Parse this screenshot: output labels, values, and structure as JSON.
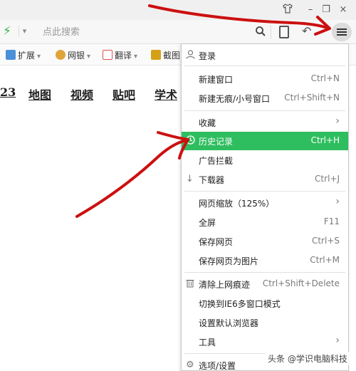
{
  "window": {
    "skin_icon": "tshirt-icon",
    "minimize_label": "–",
    "maximize_label": "❐",
    "close_label": "×"
  },
  "toolbar": {
    "search_placeholder": "点此搜索",
    "menu_icon": "hamburger-menu-icon"
  },
  "bookmarks": [
    {
      "label": "扩展",
      "color": "#4a90d9"
    },
    {
      "label": "网银",
      "color": "#e0a53a"
    },
    {
      "label": "翻译",
      "color": "#d9534f"
    },
    {
      "label": "截图",
      "color": "#d4a017"
    }
  ],
  "page_links": [
    "23",
    "地图",
    "视频",
    "贴吧",
    "学术"
  ],
  "menu": {
    "login": "登录",
    "new_window": {
      "label": "新建窗口",
      "shortcut": "Ctrl+N"
    },
    "new_incognito": {
      "label": "新建无痕/小号窗口",
      "shortcut": "Ctrl+Shift+N"
    },
    "favorites": {
      "label": "收藏"
    },
    "history": {
      "label": "历史记录",
      "shortcut": "Ctrl+H"
    },
    "ad_block": {
      "label": "广告拦截"
    },
    "downloads": {
      "label": "下载器",
      "shortcut": "Ctrl+J"
    },
    "zoom": {
      "label": "网页缩放（125%）"
    },
    "fullscreen": {
      "label": "全屏",
      "shortcut": "F11"
    },
    "save_page": {
      "label": "保存网页",
      "shortcut": "Ctrl+S"
    },
    "save_as_image": {
      "label": "保存网页为图片",
      "shortcut": "Ctrl+M"
    },
    "clear_traces": {
      "label": "清除上网痕迹",
      "shortcut": "Ctrl+Shift+Delete"
    },
    "ie6_mode": {
      "label": "切换到IE6多窗口模式"
    },
    "default_browser": {
      "label": "设置默认浏览器"
    },
    "tools": {
      "label": "工具"
    },
    "options": {
      "label": "选项/设置"
    }
  },
  "watermark": "头条 @学识电脑科技",
  "colors": {
    "highlight": "#2fbe5f",
    "annotation": "#cc1010"
  }
}
